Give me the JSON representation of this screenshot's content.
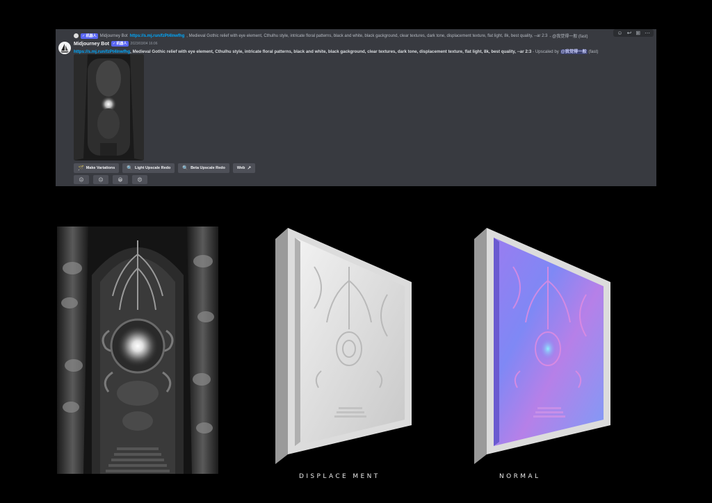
{
  "message": {
    "reply": {
      "badge": "✓ 机器人",
      "author": "Midjourney Bot",
      "link": "https://s.mj.run/fzPt4lnwfhg",
      "text": ", Medieval Gothic relief with eye element, Cthulhu style, intricate floral patterns, black and white, black gackground, clear textures, dark tone, displacement texture, flat light, 8k, best quality, --ar 2:3",
      "suffix": " - @我觉得一般 (fast)"
    },
    "author": "Midjourney Bot",
    "badge": "✓ 机器人",
    "timestamp": "2023/03/04 16:06",
    "link": "https://s.mj.run/fzPt4lnwfhg",
    "prompt": ", Medieval Gothic relief with eye element, Cthulhu style, intricate floral patterns, black and white, black gackground, clear textures, dark tone, displacement texture, flat light, 8k, best quality, --ar 2:3",
    "upscaled_by": " - Upscaled by ",
    "mention": "@我觉得一般",
    "speed": " (fast)"
  },
  "buttons": [
    {
      "icon": "🪄",
      "label": "Make Variations"
    },
    {
      "icon": "🔍",
      "label": "Light Upscale Redo"
    },
    {
      "icon": "🔍",
      "label": "Beta Upscale Redo"
    },
    {
      "icon": "",
      "label": "Web",
      "suffix_icon": "↗"
    }
  ],
  "reactions": [
    "😖",
    "😑",
    "😀",
    "😍"
  ],
  "toolbar_icons": [
    "add-reaction-icon",
    "reply-icon",
    "apps-icon",
    "more-icon"
  ],
  "captions": {
    "displacement": "DISPLACE MENT",
    "normal": "NORMAL"
  },
  "colors": {
    "discord_bg": "#383a40",
    "link": "#00a8fc",
    "button_bg": "#4e5058",
    "badge": "#5865f2"
  }
}
